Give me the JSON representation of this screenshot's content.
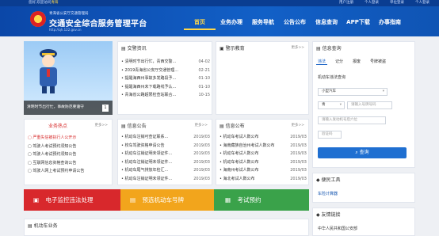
{
  "topbar": {
    "notice_prefix": "您好,欢迎访问",
    "region": "青海",
    "user_center": "用户注册",
    "login": "个人登录",
    "unit_login": "单位登录",
    "admin": "个人登录"
  },
  "header": {
    "subtitle": "青海省公安厅交通管理局",
    "title": "交通安全综合服务管理平台",
    "url": "http://qh.122.gov.cn"
  },
  "nav": [
    "首页",
    "业务办理",
    "服务导航",
    "公告公布",
    "信息查询",
    "APP下载",
    "办事指南"
  ],
  "banner": {
    "caption": "清明时节出行忙，事故防范要遵守",
    "index": "1"
  },
  "traffic_news": {
    "title": "交警资讯",
    "more": "更多>>",
    "items": [
      {
        "t": "清明时节出行忙，青西交警...",
        "d": "04-02"
      },
      {
        "t": "2019青海省公安厅交通管理...",
        "d": "02-21"
      },
      {
        "t": "提醒海西州事故多发路段予...",
        "d": "01-10"
      },
      {
        "t": "提醒海西州未下载路线予认...",
        "d": "01-10"
      },
      {
        "t": "青海省公路超限检查站联合...",
        "d": "10-15"
      }
    ]
  },
  "warning_edu": {
    "title": "警示教育",
    "more": "更多>>"
  },
  "info_query": {
    "title": "信息查询",
    "tabs": [
      "违法",
      "记分",
      "报废",
      "号牌被盗"
    ],
    "section": "机动车违法查询",
    "vehicle_type": "小型汽车",
    "plate_prefix": "青",
    "plate_placeholder": "请输入号牌号码",
    "engine_placeholder": "请输入发动机号后六位",
    "captcha_placeholder": "验证码",
    "button": "查询"
  },
  "business_hot": {
    "title": "业务热点",
    "more": "更多>>",
    "items": [
      "严重失信被执行人公开示",
      "驾驶人考试预约须知公告",
      "驾驶人考试预约须知公告",
      "互联网信息资格查询公告",
      "驾驶人网上考试预约申请公告"
    ]
  },
  "notices": {
    "title": "信息公告",
    "more": "更多>>",
    "items": [
      {
        "t": "机动车注销可查证联系...",
        "d": "2019/03"
      },
      {
        "t": "校车驾驶资格申请公告",
        "d": "2019/03"
      },
      {
        "t": "机动车注销证明未领证件...",
        "d": "2019/03"
      },
      {
        "t": "机动车注销证明未领证件...",
        "d": "2019/03"
      },
      {
        "t": "机动车尾气排放年检汇...",
        "d": "2019/03"
      },
      {
        "t": "机动车注销证明未领证件...",
        "d": "2019/03"
      }
    ]
  },
  "publish": {
    "title": "信息公布",
    "more": "更多>>",
    "items": [
      {
        "t": "机动车考试人数公布",
        "d": "2019/03"
      },
      {
        "t": "海南藏族自治州考试人数公布",
        "d": "2019/03"
      },
      {
        "t": "机动车考试人数公布",
        "d": "2019/03"
      },
      {
        "t": "机动车考试人数公布",
        "d": "2019/03"
      },
      {
        "t": "海南州考试人数公布",
        "d": "2019/03"
      },
      {
        "t": "海北考试人数公布",
        "d": "2019/03"
      }
    ]
  },
  "tiles": [
    {
      "label": "电子监控违法处理",
      "color": "#d8282c"
    },
    {
      "label": "预选机动车号牌",
      "color": "#f2a51c"
    },
    {
      "label": "考试预约",
      "color": "#3aa24a"
    }
  ],
  "convenience": {
    "title": "便民工具",
    "item": "车险计算器"
  },
  "links": {
    "title": "友情链接",
    "item": "中华人民共和国公安部"
  },
  "vehicle_biz": {
    "title": "机动车业务"
  }
}
